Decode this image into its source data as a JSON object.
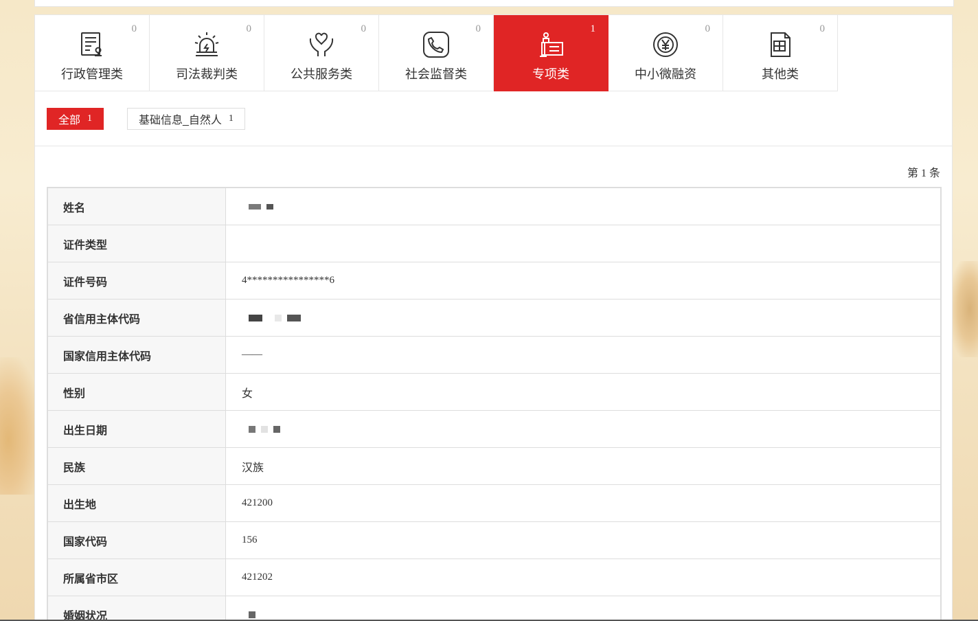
{
  "categories": [
    {
      "label": "行政管理类",
      "count": "0",
      "icon": "document-stamp-icon",
      "active": false
    },
    {
      "label": "司法裁判类",
      "count": "0",
      "icon": "alarm-siren-icon",
      "active": false
    },
    {
      "label": "公共服务类",
      "count": "0",
      "icon": "heart-hand-icon",
      "active": false
    },
    {
      "label": "社会监督类",
      "count": "0",
      "icon": "phone-icon",
      "active": false
    },
    {
      "label": "专项类",
      "count": "1",
      "icon": "certificate-icon",
      "active": true
    },
    {
      "label": "中小微融资",
      "count": "0",
      "icon": "yen-coin-icon",
      "active": false
    },
    {
      "label": "其他类",
      "count": "0",
      "icon": "grid-document-icon",
      "active": false
    }
  ],
  "filters": [
    {
      "label": "全部",
      "count": "1",
      "active": true
    },
    {
      "label": "基础信息_自然人",
      "count": "1",
      "active": false
    }
  ],
  "record_count": {
    "prefix": "第",
    "value": "1",
    "suffix": "条"
  },
  "rows": [
    {
      "key": "姓名",
      "value": "",
      "masked": true
    },
    {
      "key": "证件类型",
      "value": ""
    },
    {
      "key": "证件号码",
      "value": "4****************6"
    },
    {
      "key": "省信用主体代码",
      "value": "",
      "masked": true
    },
    {
      "key": "国家信用主体代码",
      "value": "——"
    },
    {
      "key": "性别",
      "value": "女",
      "cn": true
    },
    {
      "key": "出生日期",
      "value": "",
      "masked": true
    },
    {
      "key": "民族",
      "value": "汉族",
      "cn": true
    },
    {
      "key": "出生地",
      "value": "421200"
    },
    {
      "key": "国家代码",
      "value": "156"
    },
    {
      "key": "所属省市区",
      "value": "421202"
    },
    {
      "key": "婚姻状况",
      "value": "",
      "masked": true
    }
  ],
  "colors": {
    "accent": "#e02525",
    "border": "#e6e6e6",
    "key_bg": "#f7f7f7"
  }
}
